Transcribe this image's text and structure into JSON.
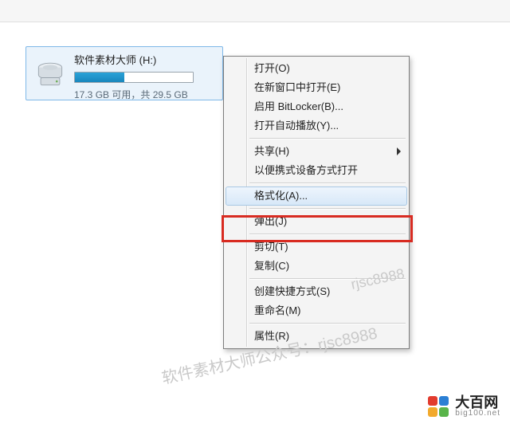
{
  "drive": {
    "title": "软件素材大师 (H:)",
    "usage_text": "17.3 GB 可用，共 29.5 GB",
    "fill_percent": 42
  },
  "menu": {
    "items": [
      {
        "label": "打开(O)",
        "submenu": false
      },
      {
        "label": "在新窗口中打开(E)",
        "submenu": false
      },
      {
        "label": "启用 BitLocker(B)...",
        "submenu": false
      },
      {
        "label": "打开自动播放(Y)...",
        "submenu": false
      },
      "sep",
      {
        "label": "共享(H)",
        "submenu": true
      },
      {
        "label": "以便携式设备方式打开",
        "submenu": false
      },
      "sep",
      {
        "label": "格式化(A)...",
        "submenu": false,
        "hover": true,
        "highlighted": true
      },
      "sep",
      {
        "label": "弹出(J)",
        "submenu": false
      },
      "sep",
      {
        "label": "剪切(T)",
        "submenu": false
      },
      {
        "label": "复制(C)",
        "submenu": false
      },
      "sep",
      {
        "label": "创建快捷方式(S)",
        "submenu": false
      },
      {
        "label": "重命名(M)",
        "submenu": false
      },
      "sep",
      {
        "label": "属性(R)",
        "submenu": false
      }
    ]
  },
  "watermark": {
    "line1": "软件素材大师公众号：rjsc8988",
    "line2": "rjsc8988"
  },
  "brand": {
    "cn": "大百网",
    "en": "big100.net"
  }
}
